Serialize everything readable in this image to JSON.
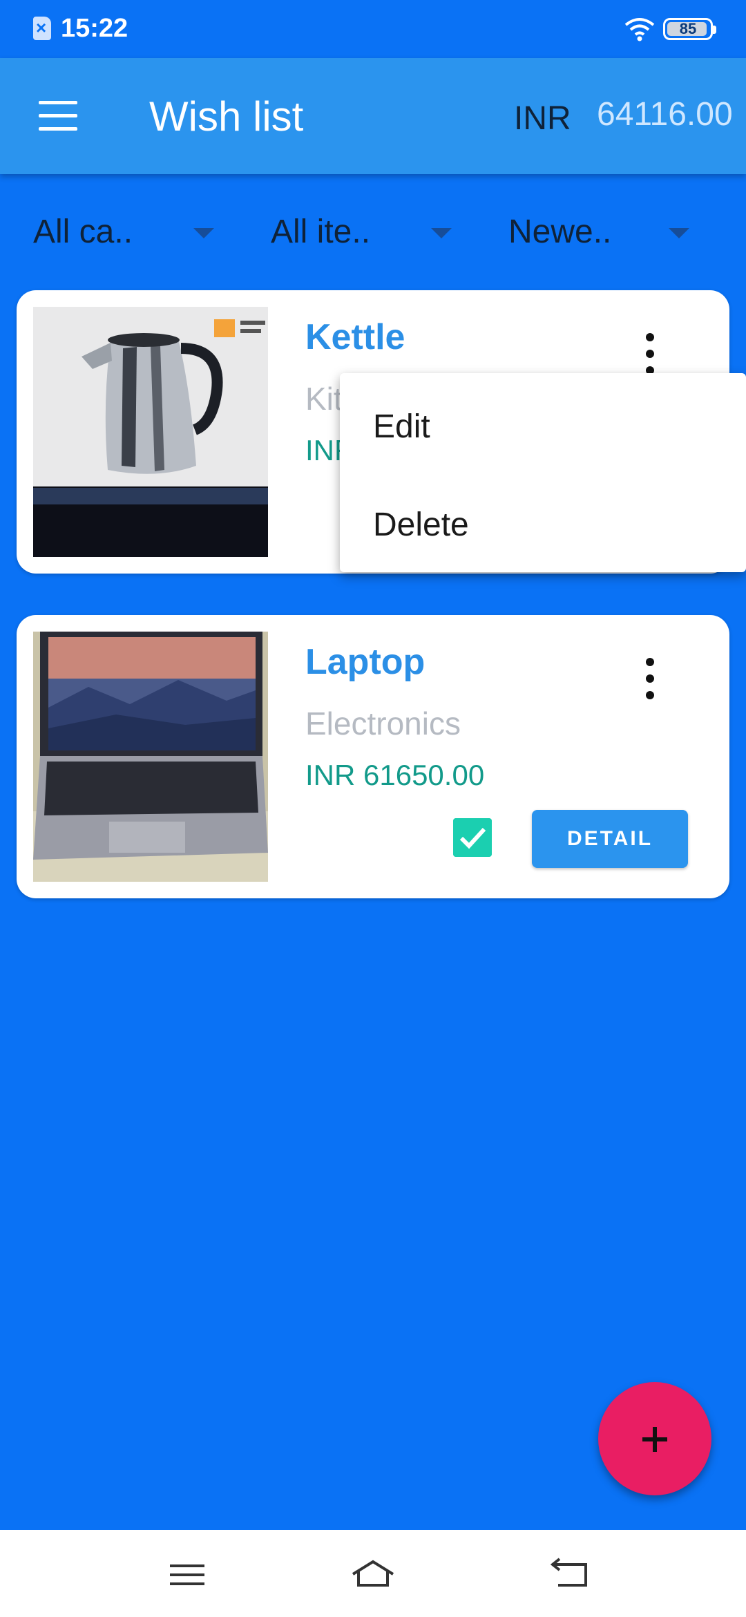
{
  "status_bar": {
    "time": "15:22",
    "battery": "85"
  },
  "app_bar": {
    "title": "Wish list",
    "currency": "INR",
    "balance": "64116.00"
  },
  "filters": [
    {
      "label": "All ca.."
    },
    {
      "label": "All ite.."
    },
    {
      "label": "Newe.."
    }
  ],
  "items": [
    {
      "name": "Kettle",
      "category": "Kitchen",
      "price": "INR"
    },
    {
      "name": "Laptop",
      "category": "Electronics",
      "price": "INR 61650.00",
      "checked": true,
      "detail_label": "DETAIL"
    }
  ],
  "popup_menu": {
    "edit_label": "Edit",
    "delete_label": "Delete"
  },
  "colors": {
    "background": "#0a72f5",
    "app_bar": "#2b94ee",
    "accent_teal": "#129a8a",
    "fab": "#e91e63"
  },
  "icons": [
    "sim-icon",
    "wifi-icon",
    "battery-icon",
    "hamburger-menu-icon",
    "dropdown-arrow-icon",
    "more-vert-icon",
    "checkbox-checked-icon",
    "add-icon",
    "nav-menu-icon",
    "nav-home-icon",
    "nav-back-icon"
  ]
}
